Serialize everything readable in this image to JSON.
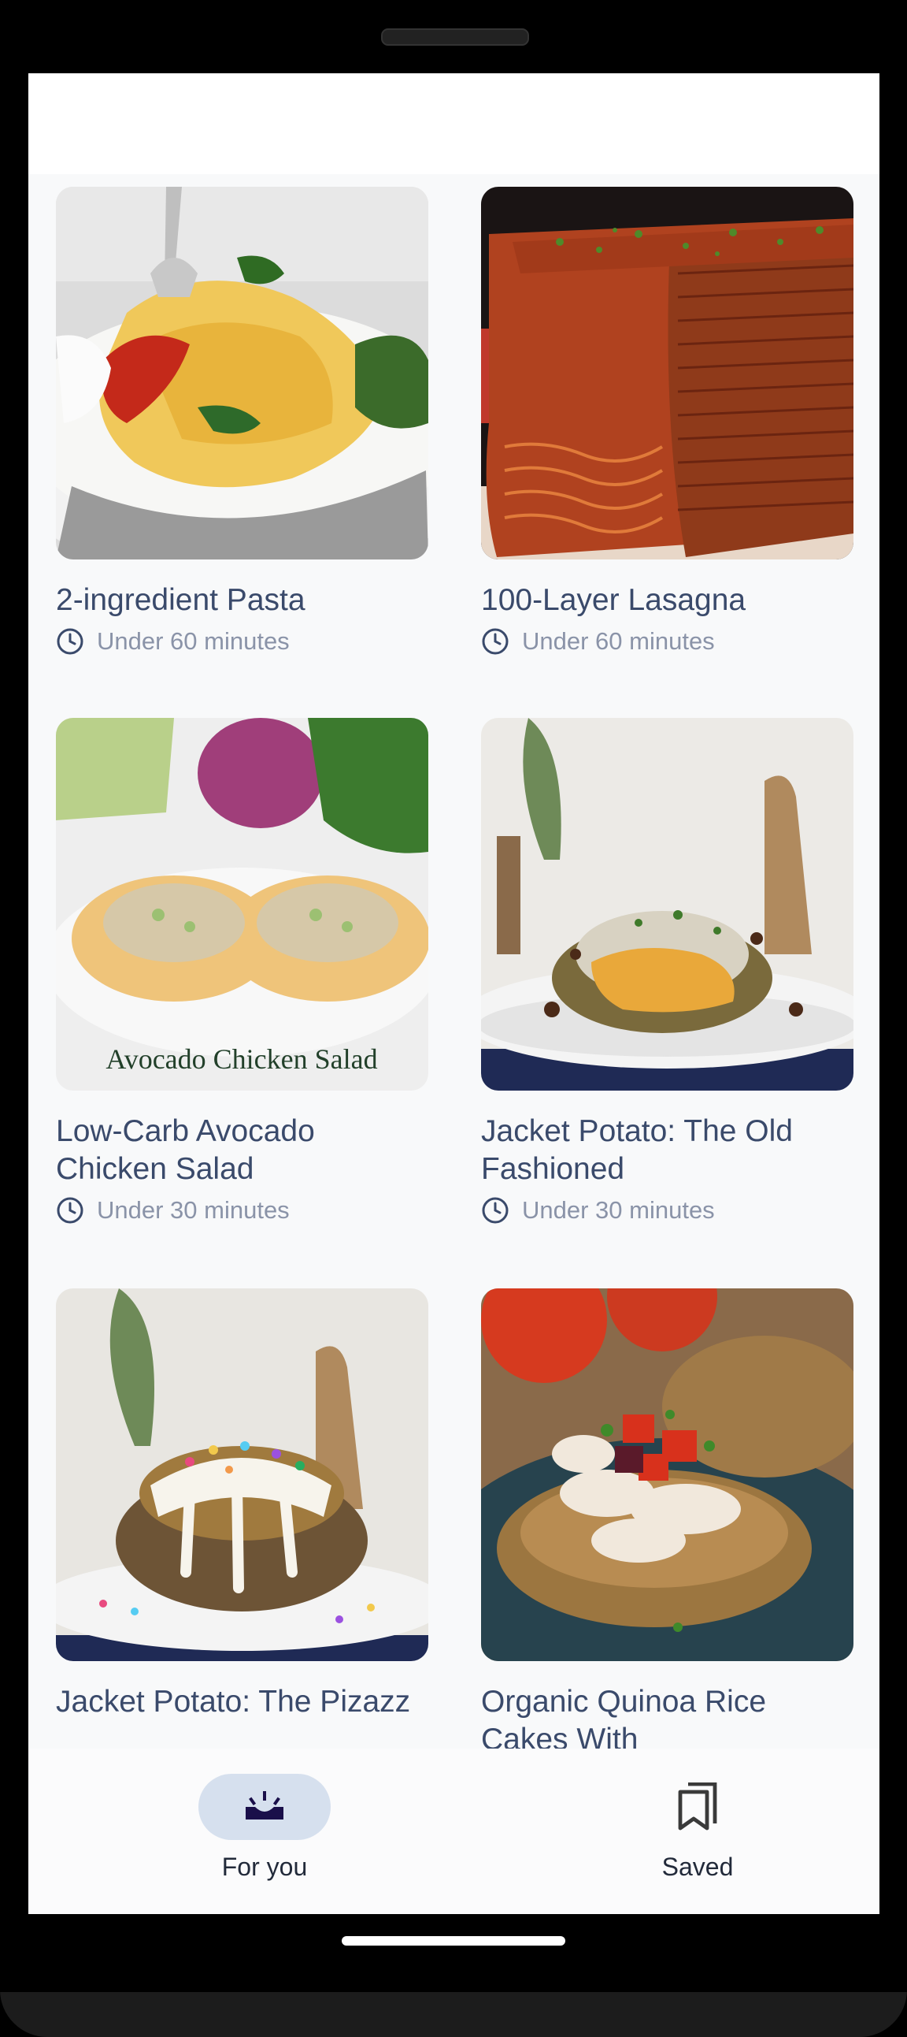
{
  "recipes": [
    {
      "title": "2-ingredient Pasta",
      "time": "Under 60 minutes"
    },
    {
      "title": "100-Layer Lasagna",
      "time": "Under 60 minutes"
    },
    {
      "title": "Low-Carb Avocado Chicken Salad",
      "time": "Under 30 minutes",
      "image_caption": "Avocado Chicken Salad"
    },
    {
      "title": "Jacket Potato: The Old Fashioned",
      "time": "Under 30 minutes"
    },
    {
      "title": "Jacket Potato: The Pizazz",
      "time": ""
    },
    {
      "title": "Organic Quinoa Rice Cakes With",
      "time": ""
    }
  ],
  "nav": {
    "for_you": {
      "label": "For you",
      "icon": "for-you-icon"
    },
    "saved": {
      "label": "Saved",
      "icon": "bookmarks-icon"
    }
  },
  "colors": {
    "accent": "#d6e0ee",
    "title": "#3a4a6b",
    "meta": "#8a93a8"
  }
}
